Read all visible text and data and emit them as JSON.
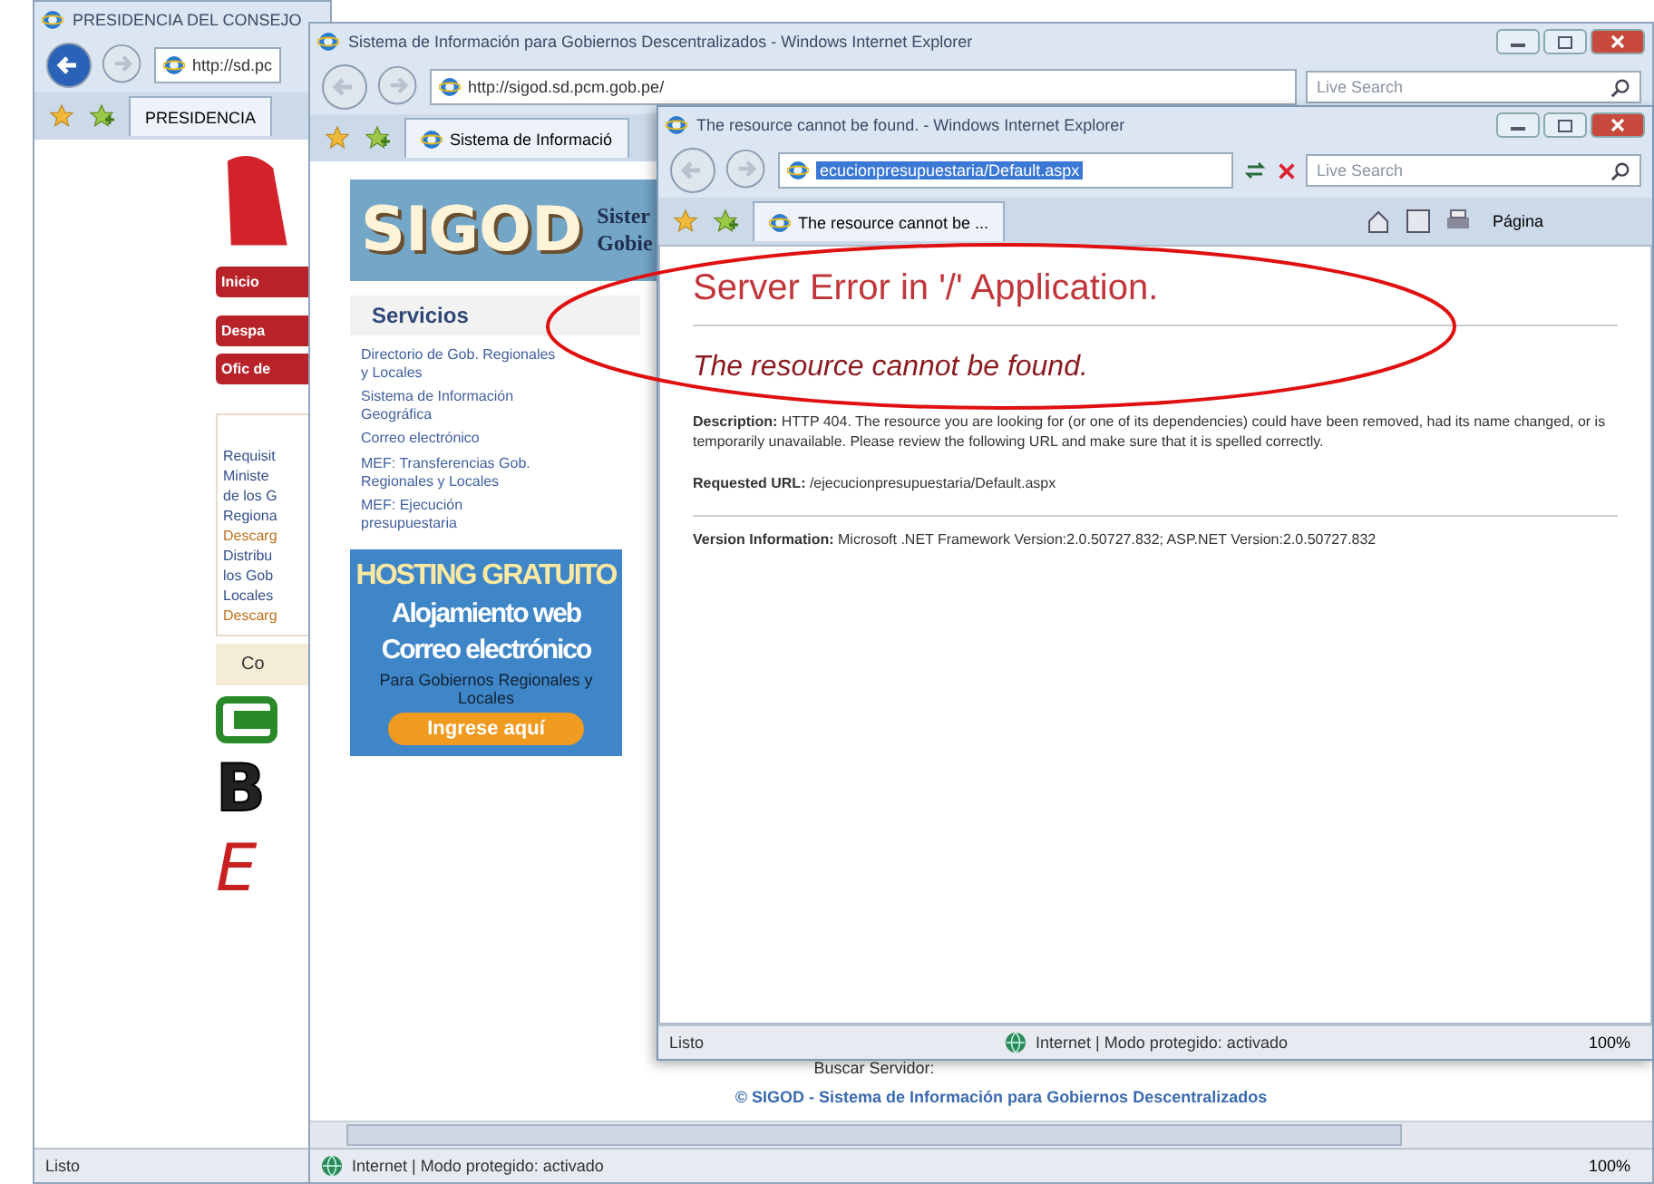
{
  "back_window": {
    "title": "PRESIDENCIA DEL CONSEJO",
    "address": "http://sd.pc",
    "tab": "PRESIDENCIA",
    "menu_buttons": [
      "Inicio",
      "Despa",
      "Ofic de"
    ],
    "links": [
      {
        "text": "Requisit",
        "kind": "link"
      },
      {
        "text": "Ministe",
        "kind": "link"
      },
      {
        "text": "de los G",
        "kind": "link"
      },
      {
        "text": "Regiona",
        "kind": "link"
      },
      {
        "text": "Descarg",
        "kind": "download"
      },
      {
        "text": "Distribu",
        "kind": "link"
      },
      {
        "text": "los Gob",
        "kind": "link"
      },
      {
        "text": "Locales",
        "kind": "link"
      },
      {
        "text": "Descarg",
        "kind": "download"
      }
    ],
    "section_heading": "Co",
    "partner_logos": [
      "B",
      "E"
    ],
    "status": "Listo"
  },
  "middle_window": {
    "title": "Sistema de Información para Gobiernos Descentralizados - Windows Internet Explorer",
    "address": "http://sigod.sd.pcm.gob.pe/",
    "search_placeholder": "Live Search",
    "tab": "Sistema de Informació",
    "logo": "SIGOD",
    "header_lines": [
      "Sister",
      "Gobie"
    ],
    "services_heading": "Servicios",
    "services": [
      "Directorio de Gob. Regionales y Locales",
      "Sistema de Información Geográfica",
      "Correo electrónico",
      "MEF: Transferencias Gob. Regionales y Locales",
      "MEF: Ejecución presupuestaria"
    ],
    "ad": {
      "headline": "HOSTING GRATUITO",
      "lines": [
        "Alojamiento web",
        "Correo electrónico"
      ],
      "subtitle": "Para Gobiernos Regionales y Locales",
      "button": "Ingrese aquí"
    },
    "search_label": "Buscar Servidor:",
    "footer": "© SIGOD - Sistema de Información para Gobiernos Descentralizados",
    "status_zone": "Internet | Modo protegido: activado",
    "zoom": "100%"
  },
  "front_window": {
    "title": "The resource cannot be found. - Windows Internet Explorer",
    "address": "ecucionpresupuestaria/Default.aspx",
    "address_selected": true,
    "search_placeholder": "Live Search",
    "tab": "The resource cannot be ...",
    "page_menu": "Página",
    "heading": "Server Error in '/' Application.",
    "subheading": "The resource cannot be found.",
    "details": [
      "**Description:** HTTP 404. The resource you are looking for (or one of its dependencies) could have been removed, had its name changed, or is temporarily unavailable.  Please review the following URL and make sure that it is spelled correctly.",
      "**Requested URL:** /ejecucionpresupuestaria/Default.aspx",
      "**Version Information:** Microsoft .NET Framework Version:2.0.50727.832; ASP.NET Version:2.0.50727.832"
    ],
    "status": "Listo",
    "status_zone": "Internet | Modo protegido: activado",
    "zoom": "100%"
  }
}
